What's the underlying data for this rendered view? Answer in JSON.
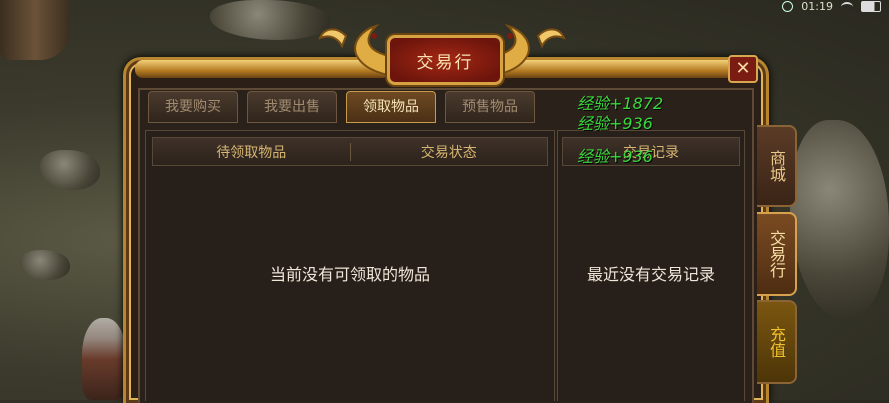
{
  "status_bar": {
    "time": "01:19"
  },
  "window": {
    "title": "交易行",
    "close_label": "✕"
  },
  "tabs": [
    {
      "label": "我要购买",
      "active": false
    },
    {
      "label": "我要出售",
      "active": false
    },
    {
      "label": "领取物品",
      "active": true
    },
    {
      "label": "预售物品",
      "active": false
    }
  ],
  "left_panel": {
    "columns": [
      "待领取物品",
      "交易状态"
    ],
    "empty_message": "当前没有可领取的物品"
  },
  "right_panel": {
    "header": "交易记录",
    "empty_message": "最近没有交易记录"
  },
  "exp_notifications": [
    "经验+1872",
    "经验+936",
    "经验+936"
  ],
  "side_tabs": [
    {
      "label": "商城",
      "active": false
    },
    {
      "label": "交易行",
      "active": true
    },
    {
      "label": "充值",
      "active": false
    }
  ],
  "colors": {
    "gold": "#d6a242",
    "exp_green": "#39d83c",
    "panel_bg": "#271f1a",
    "title_red": "#8b1e10"
  }
}
